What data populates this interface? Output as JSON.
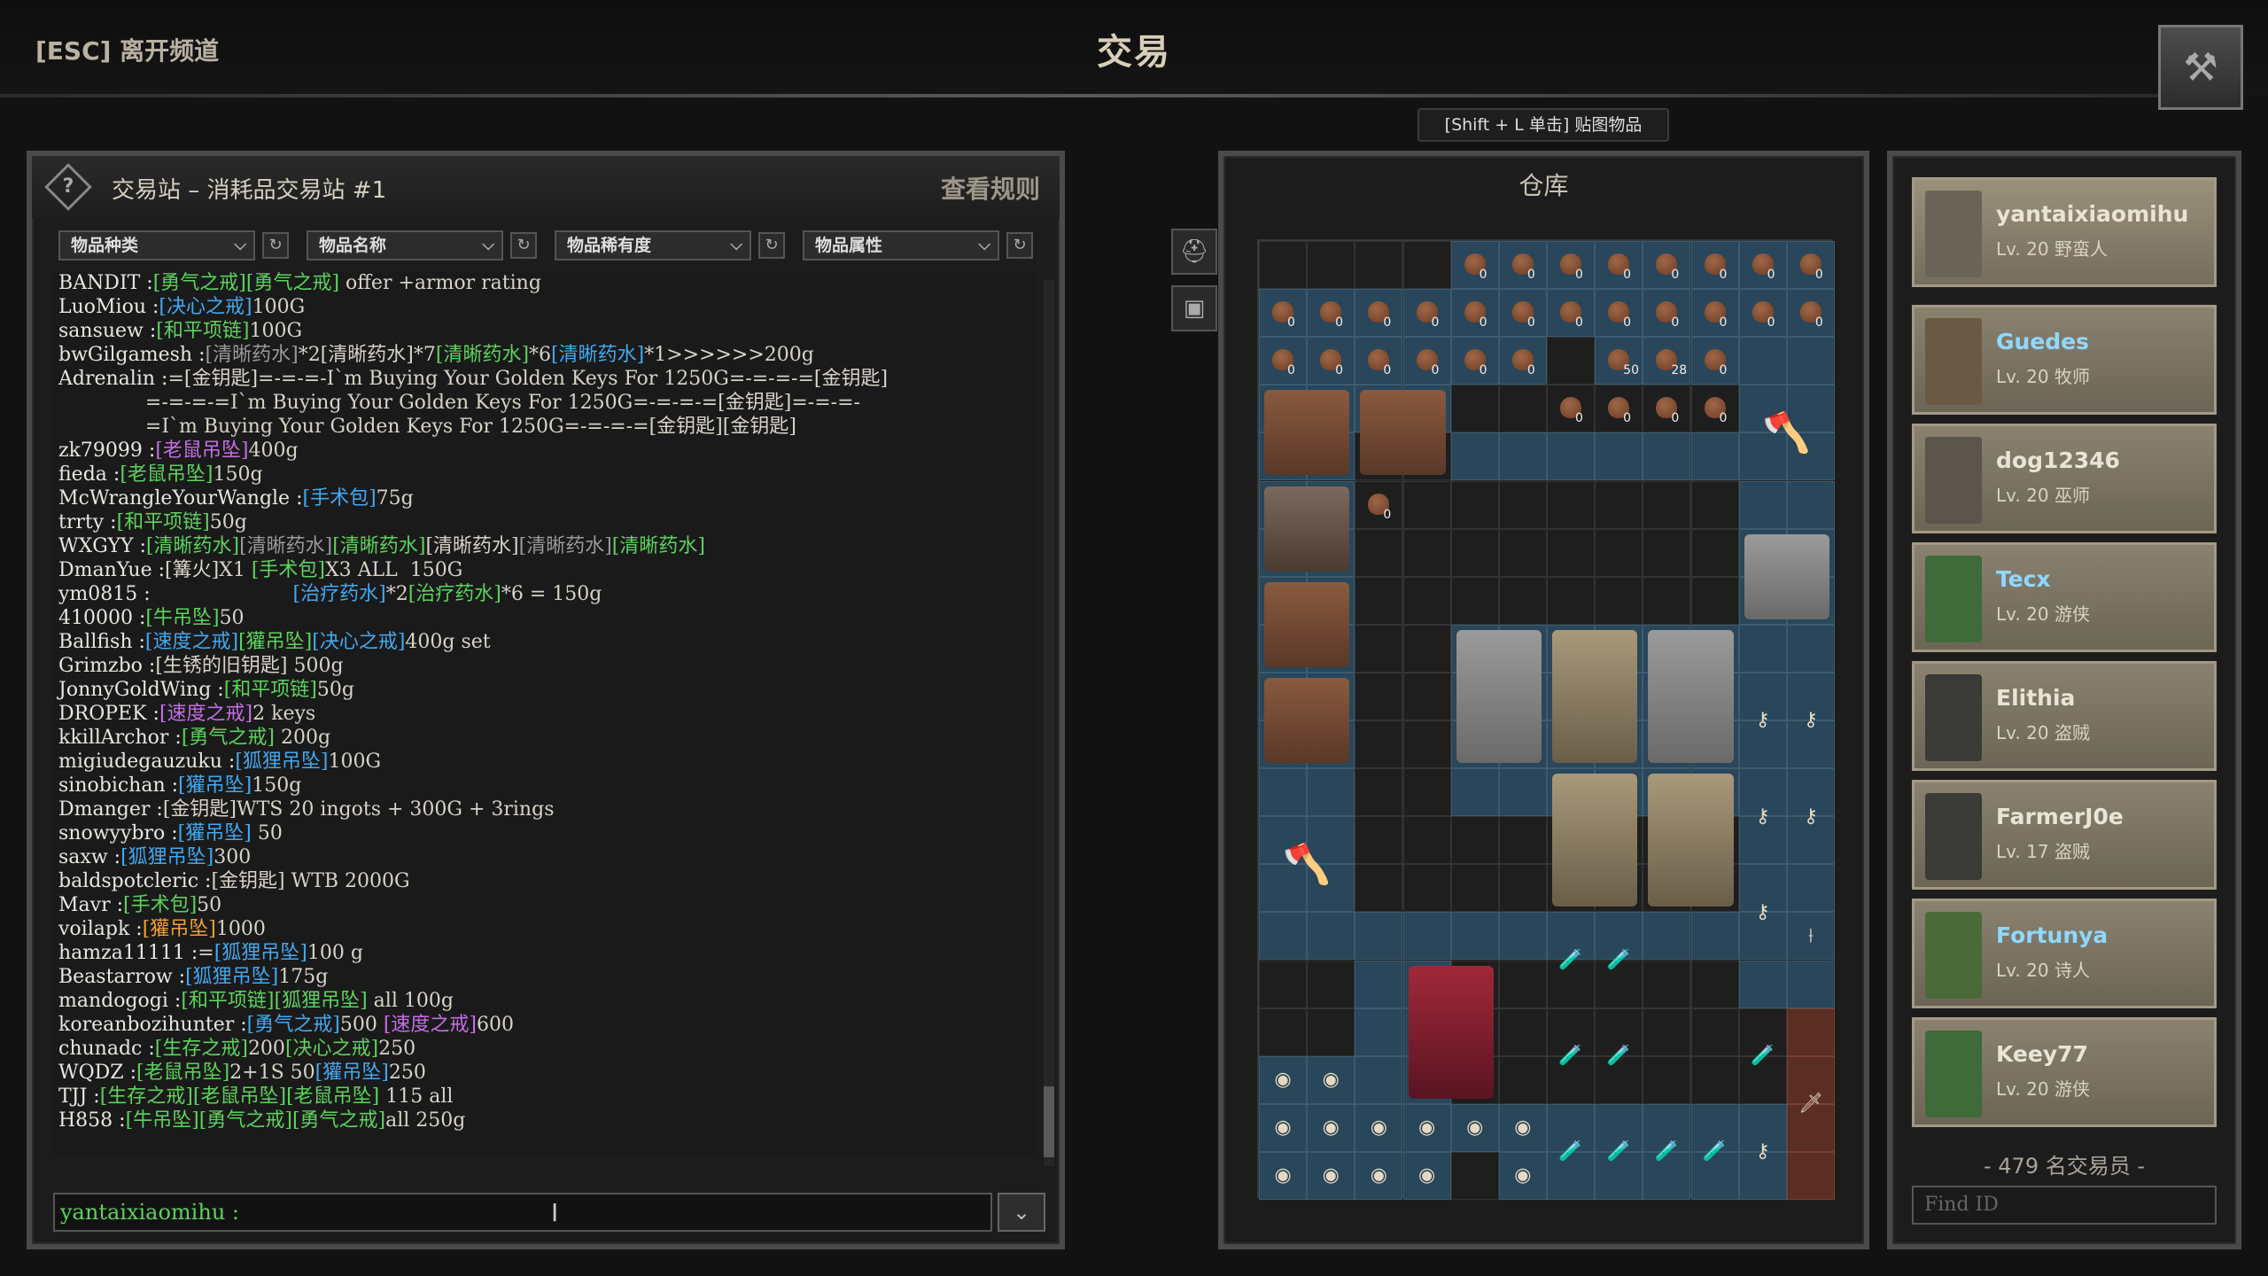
{
  "header": {
    "exit_label": "[ESC] 离开频道",
    "title": "交易",
    "stash_hint": "[Shift + L 单击] 贴图物品"
  },
  "chat": {
    "panel_title": "交易站 – 消耗品交易站 #1",
    "rules_label": "查看规则",
    "filters": [
      "物品种类",
      "物品名称",
      "物品稀有度",
      "物品属性"
    ],
    "input_user": "yantaixiaomihu :",
    "messages": [
      {
        "user": "BANDIT :",
        "parts": [
          {
            "t": "[勇气之戒]",
            "c": "green"
          },
          {
            "t": "[勇气之戒]",
            "c": "green"
          },
          {
            "t": " offer +armor rating",
            "c": ""
          }
        ]
      },
      {
        "user": "LuoMiou :",
        "parts": [
          {
            "t": "[决心之戒]",
            "c": "blue"
          },
          {
            "t": "100G",
            "c": ""
          }
        ]
      },
      {
        "user": "sansuew :",
        "parts": [
          {
            "t": "[和平项链]",
            "c": "green"
          },
          {
            "t": "100G",
            "c": ""
          }
        ]
      },
      {
        "user": "bwGilgamesh :",
        "parts": [
          {
            "t": "[清晰药水]",
            "c": "gray"
          },
          {
            "t": "*2[清晰药水]*7",
            "c": ""
          },
          {
            "t": "[清晰药水]",
            "c": "green"
          },
          {
            "t": "*6",
            "c": ""
          },
          {
            "t": "[清晰药水]",
            "c": "blue"
          },
          {
            "t": "*1>>>>>>200g",
            "c": ""
          }
        ]
      },
      {
        "user": "Adrenalin :",
        "parts": [
          {
            "t": "=[金钥匙]=-=-=-I`m Buying Your Golden Keys For 1250G=-=-=-=[金钥匙]",
            "c": ""
          }
        ]
      },
      {
        "user": "",
        "parts": [
          {
            "t": "              =-=-=-=I`m Buying Your Golden Keys For 1250G=-=-=-=[金钥匙]=-=-=-",
            "c": ""
          }
        ]
      },
      {
        "user": "",
        "parts": [
          {
            "t": "              =I`m Buying Your Golden Keys For 1250G=-=-=-=[金钥匙][金钥匙]",
            "c": ""
          }
        ]
      },
      {
        "user": "zk79099 :",
        "parts": [
          {
            "t": "[老鼠吊坠]",
            "c": "purple"
          },
          {
            "t": "400g",
            "c": ""
          }
        ]
      },
      {
        "user": "fieda :",
        "parts": [
          {
            "t": "[老鼠吊坠]",
            "c": "green"
          },
          {
            "t": "150g",
            "c": ""
          }
        ]
      },
      {
        "user": "McWrangleYourWangle :",
        "parts": [
          {
            "t": "[手术包]",
            "c": "blue"
          },
          {
            "t": "75g",
            "c": ""
          }
        ]
      },
      {
        "user": "trrty :",
        "parts": [
          {
            "t": "[和平项链]",
            "c": "green"
          },
          {
            "t": "50g",
            "c": ""
          }
        ]
      },
      {
        "user": "WXGYY :",
        "parts": [
          {
            "t": "[清晰药水]",
            "c": "green"
          },
          {
            "t": "[清晰药水]",
            "c": "gray"
          },
          {
            "t": "[清晰药水]",
            "c": "green"
          },
          {
            "t": "[清晰药水]",
            "c": ""
          },
          {
            "t": "[清晰药水]",
            "c": "gray"
          },
          {
            "t": "[清晰药水]",
            "c": "green"
          }
        ]
      },
      {
        "user": "DmanYue :",
        "parts": [
          {
            "t": "[篝火]X1 ",
            "c": ""
          },
          {
            "t": "[手术包]",
            "c": "green"
          },
          {
            "t": "X3 ALL  150G",
            "c": ""
          }
        ]
      },
      {
        "user": "ym0815 :",
        "parts": [
          {
            "t": "                       ",
            "c": ""
          },
          {
            "t": "[治疗药水]",
            "c": "blue"
          },
          {
            "t": "*2",
            "c": ""
          },
          {
            "t": "[治疗药水]",
            "c": "green"
          },
          {
            "t": "*6 = 150g",
            "c": ""
          }
        ]
      },
      {
        "user": "410000 :",
        "parts": [
          {
            "t": "[牛吊坠]",
            "c": "green"
          },
          {
            "t": "50",
            "c": ""
          }
        ]
      },
      {
        "user": "Ballfish :",
        "parts": [
          {
            "t": "[速度之戒]",
            "c": "blue"
          },
          {
            "t": "[獾吊坠]",
            "c": "green"
          },
          {
            "t": "[决心之戒]",
            "c": "blue"
          },
          {
            "t": "400g set",
            "c": ""
          }
        ]
      },
      {
        "user": "Grimzbo :",
        "parts": [
          {
            "t": "[生锈的旧钥匙] 500g",
            "c": ""
          }
        ]
      },
      {
        "user": "JonnyGoldWing :",
        "parts": [
          {
            "t": "[和平项链]",
            "c": "green"
          },
          {
            "t": "50g",
            "c": ""
          }
        ]
      },
      {
        "user": "DROPEK :",
        "parts": [
          {
            "t": "[速度之戒]",
            "c": "purple"
          },
          {
            "t": "2 keys",
            "c": ""
          }
        ]
      },
      {
        "user": "kkillArchor :",
        "parts": [
          {
            "t": "[勇气之戒]",
            "c": "green"
          },
          {
            "t": " 200g",
            "c": ""
          }
        ]
      },
      {
        "user": "migiudegauzuku :",
        "parts": [
          {
            "t": "[狐狸吊坠]",
            "c": "blue"
          },
          {
            "t": "100G",
            "c": ""
          }
        ]
      },
      {
        "user": "sinobichan :",
        "parts": [
          {
            "t": "[獾吊坠]",
            "c": "blue"
          },
          {
            "t": "150g",
            "c": ""
          }
        ]
      },
      {
        "user": "Dmanger :",
        "parts": [
          {
            "t": "[金钥匙]WTS 20 ingots + 300G + 3rings",
            "c": ""
          }
        ]
      },
      {
        "user": "snowyybro :",
        "parts": [
          {
            "t": "[獾吊坠]",
            "c": "blue"
          },
          {
            "t": " 50",
            "c": ""
          }
        ]
      },
      {
        "user": "saxw :",
        "parts": [
          {
            "t": "[狐狸吊坠]",
            "c": "blue"
          },
          {
            "t": "300",
            "c": ""
          }
        ]
      },
      {
        "user": "baldspotcleric :",
        "parts": [
          {
            "t": "[金钥匙] WTB 2000G",
            "c": ""
          }
        ]
      },
      {
        "user": "Mavr :",
        "parts": [
          {
            "t": "[手术包]",
            "c": "green"
          },
          {
            "t": "50",
            "c": ""
          }
        ]
      },
      {
        "user": "voilapk :",
        "parts": [
          {
            "t": "[獾吊坠]",
            "c": "orange"
          },
          {
            "t": "1000",
            "c": ""
          }
        ]
      },
      {
        "user": "hamza11111 :",
        "parts": [
          {
            "t": "=",
            "c": ""
          },
          {
            "t": "[狐狸吊坠]",
            "c": "blue"
          },
          {
            "t": "100 g",
            "c": ""
          }
        ]
      },
      {
        "user": "Beastarrow :",
        "parts": [
          {
            "t": "[狐狸吊坠]",
            "c": "blue"
          },
          {
            "t": "175g",
            "c": ""
          }
        ]
      },
      {
        "user": "mandogogi :",
        "parts": [
          {
            "t": "[和平项链]",
            "c": "green"
          },
          {
            "t": "[狐狸吊坠]",
            "c": "green"
          },
          {
            "t": " all 100g",
            "c": ""
          }
        ]
      },
      {
        "user": "koreanbozihunter :",
        "parts": [
          {
            "t": "[勇气之戒]",
            "c": "blue"
          },
          {
            "t": "500 ",
            "c": ""
          },
          {
            "t": "[速度之戒]",
            "c": "purple"
          },
          {
            "t": "600",
            "c": ""
          }
        ]
      },
      {
        "user": "chunadc :",
        "parts": [
          {
            "t": "[生存之戒]",
            "c": "green"
          },
          {
            "t": "200",
            "c": ""
          },
          {
            "t": "[决心之戒]",
            "c": "green"
          },
          {
            "t": "250",
            "c": ""
          }
        ]
      },
      {
        "user": "WQDZ :",
        "parts": [
          {
            "t": "[老鼠吊坠]",
            "c": "green"
          },
          {
            "t": "2+1S 50",
            "c": ""
          },
          {
            "t": "[獾吊坠]",
            "c": "blue"
          },
          {
            "t": "250",
            "c": ""
          }
        ]
      },
      {
        "user": "TJJ :",
        "parts": [
          {
            "t": "[生存之戒]",
            "c": "green"
          },
          {
            "t": "[老鼠吊坠]",
            "c": "green"
          },
          {
            "t": "[老鼠吊坠]",
            "c": "green"
          },
          {
            "t": " 115 all",
            "c": ""
          }
        ]
      },
      {
        "user": "H858 :",
        "parts": [
          {
            "t": "[牛吊坠]",
            "c": "green"
          },
          {
            "t": "[勇气之戒]",
            "c": "green"
          },
          {
            "t": "[勇气之戒]",
            "c": "green"
          },
          {
            "t": "all 250g",
            "c": ""
          }
        ]
      }
    ]
  },
  "stash": {
    "title": "仓库",
    "pouch_counts": [
      "0",
      "0",
      "0",
      "0",
      "0",
      "0",
      "0",
      "0",
      "0",
      "0",
      "0",
      "0",
      "0",
      "0",
      "0",
      "0",
      "0",
      "0",
      "0",
      "0",
      "0",
      "0",
      "0",
      "0",
      "0",
      "0",
      "50",
      "28",
      "0",
      "0",
      "0",
      "0",
      "0",
      "0"
    ]
  },
  "traders": {
    "list": [
      {
        "name": "yantaixiaomihu",
        "level": "Lv. 20 野蛮人",
        "color": "#e9e4d6",
        "avatar": "#6a6458"
      },
      {
        "name": "Guedes",
        "level": "Lv. 20 牧师",
        "color": "#8fd8ff",
        "avatar": "#6a5a44"
      },
      {
        "name": "dog12346",
        "level": "Lv. 20 巫师",
        "color": "#e9e4d6",
        "avatar": "#5a564c"
      },
      {
        "name": "Tecx",
        "level": "Lv. 20 游侠",
        "color": "#8fd8ff",
        "avatar": "#3f6a3a"
      },
      {
        "name": "Elithia",
        "level": "Lv. 20 盗贼",
        "color": "#e9e4d6",
        "avatar": "#3a3a36"
      },
      {
        "name": "FarmerJ0e",
        "level": "Lv. 17 盗贼",
        "color": "#e9e4d6",
        "avatar": "#3a3a36"
      },
      {
        "name": "Fortunya",
        "level": "Lv. 20 诗人",
        "color": "#8fd8ff",
        "avatar": "#4a6a3a"
      },
      {
        "name": "Keey77",
        "level": "Lv. 20 游侠",
        "color": "#e9e4d6",
        "avatar": "#3f6a3a"
      }
    ],
    "count_label": "- 479 名交易员 -",
    "find_placeholder": "Find ID"
  }
}
